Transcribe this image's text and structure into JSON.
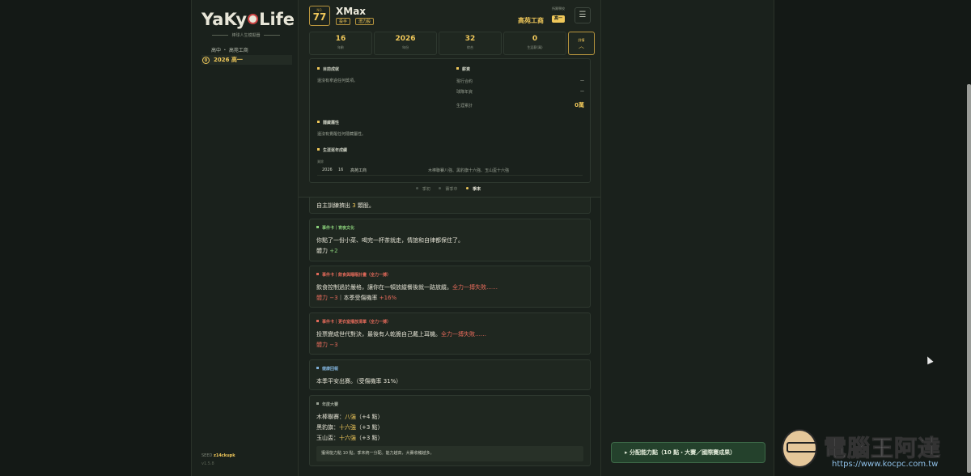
{
  "sidebar": {
    "logo_parts": [
      "YaKy",
      "Life"
    ],
    "logo_subtitle": "棒球人生模擬器",
    "school": "高中 ・ 高苑工商",
    "year_index": "0",
    "year_label": "2026 高一",
    "seed_label": "SEED",
    "seed_value": "z14ckupk",
    "version": "v1.5.8"
  },
  "header": {
    "no_label": "NO.",
    "no_value": "77",
    "player_name": "XMax",
    "tags": [
      "投手",
      "潛力股"
    ],
    "team_label": "所屬學校",
    "team_name": "高苑工商",
    "grade": "高一",
    "menu_icon": "☰",
    "stats": [
      {
        "value": "16",
        "label": "年齡"
      },
      {
        "value": "2026",
        "label": "年份"
      },
      {
        "value": "32",
        "label": "綜合"
      },
      {
        "value": "0",
        "label": "生涯薪(萬)"
      }
    ],
    "detail_label": "詳情",
    "detail_chevron": "︿"
  },
  "detail": {
    "achievements_title": "目前成就",
    "achievements_text": "還沒有拿過任何獎項。",
    "salary_title": "薪資",
    "salary_rows": [
      {
        "k": "現行合約",
        "v": "—"
      },
      {
        "k": "球隊年資",
        "v": "—"
      },
      {
        "k": "生涯累計",
        "v": "0萬"
      }
    ],
    "hidden_title": "隱藏屬性",
    "hidden_text": "還沒有覺醒任何隱藏屬性。",
    "career_title": "生涯逐年成績",
    "career_head": "業餘",
    "career_row": {
      "year": "2026",
      "age": "16",
      "team": "高苑工商",
      "result": "木棒聯賽八強、黑豹旗十六強、玉山盃十六強"
    }
  },
  "phases": [
    "季初",
    "賽季中",
    "季末"
  ],
  "feed": {
    "top_line_pre": "自主訓練擠出",
    "top_line_num": "3",
    "top_line_post": "顆股。",
    "cards": [
      {
        "title": "事件卡｜宵夜文化",
        "l1": "你點了一份小菜、喝完一杯茶就走，情誼和自律都保住了。",
        "l2_pre": "體力",
        "l2_val": "+2"
      },
      {
        "title": "事件卡｜飲食與睡眠計畫（全力一搏）",
        "l1_pre": "飲食控制過於嚴格，讓你在一頓放縱餐後就一路放縱。",
        "l1_hl": "全力一搏失敗……",
        "l2_a": "體力 −3",
        "l2_b": "｜本季受傷機率",
        "l2_c": "+16%"
      },
      {
        "title": "事件卡｜更衣室播放清單（全力一搏）",
        "l1_pre": "投票變成世代對決，最後有人乾脆自己戴上耳機。",
        "l1_hl": "全力一搏失敗……",
        "l2_a": "體力 −3"
      },
      {
        "title": "健康回報",
        "l1": "本季平安出賽。（受傷機率 31%）"
      },
      {
        "title": "年度大賽",
        "rows": [
          {
            "name": "木棒聯賽：",
            "result": "八強",
            "pts": "（+4 點）"
          },
          {
            "name": "黑豹旗：",
            "result": "十六強",
            "pts": "（+3 點）"
          },
          {
            "name": "玉山盃：",
            "result": "十六強",
            "pts": "（+3 點）"
          }
        ],
        "note": "獲得能力點 10 點，季末統一分配。能力越高，大賽收穫越多。"
      }
    ]
  },
  "alloc_button": "▸ 分配能力點（10 點・大賽／國際賽成果）",
  "watermark": {
    "text": "電腦王阿達",
    "url": "https://www.kocpc.com.tw"
  }
}
